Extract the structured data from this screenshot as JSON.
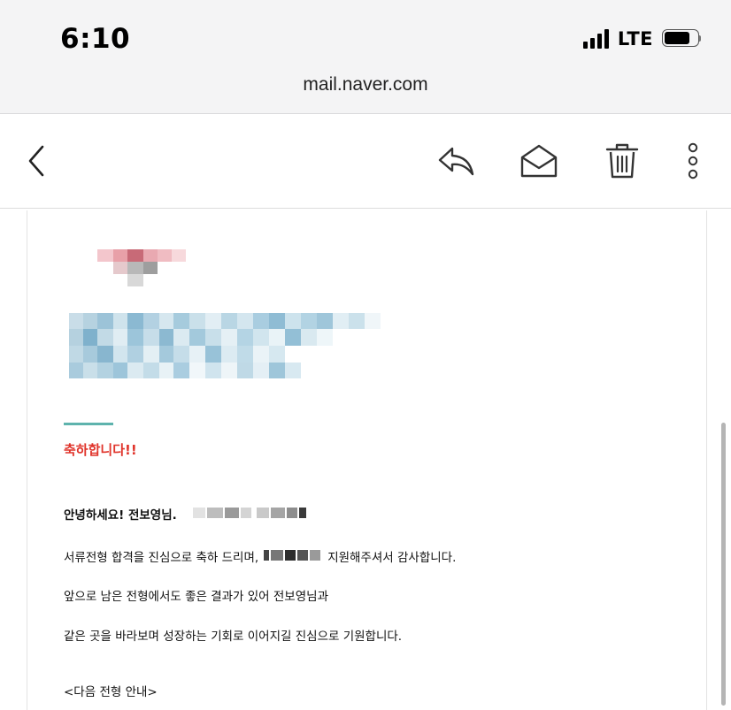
{
  "status_bar": {
    "time": "6:10",
    "network": "LTE"
  },
  "browser": {
    "url": "mail.naver.com"
  },
  "toolbar": {
    "icons": [
      "chevron-left-icon",
      "reply-icon",
      "mark-unread-icon",
      "trash-icon",
      "more-vertical-icon"
    ]
  },
  "email": {
    "congrats": "축하합니다!!",
    "greeting": "안녕하세요! 전보영님.",
    "line1_before": "서류전형 합격을 진심으로 축하 드리며,",
    "line1_after": "지원해주셔서 감사합니다.",
    "line2": "앞으로 남은 전형에서도 좋은 결과가 있어 전보영님과",
    "line3": "같은 곳을 바라보며 성장하는 기회로 이어지길 진심으로 기원합니다.",
    "line4": "<다음 전형 안내>"
  },
  "colors": {
    "accent_line": "#5eb3ad",
    "congrats_red": "#e0342b"
  }
}
